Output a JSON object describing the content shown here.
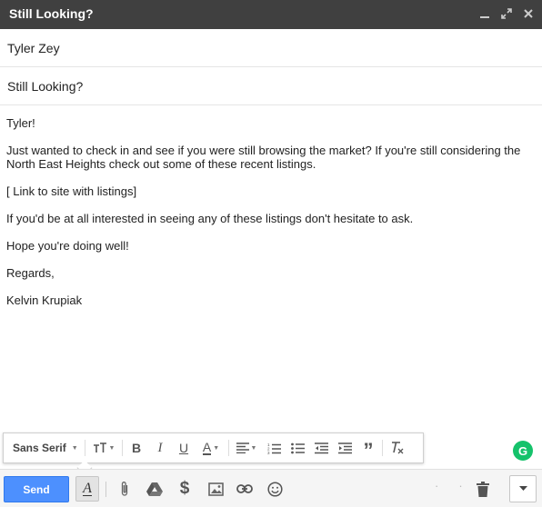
{
  "window": {
    "title": "Still Looking?"
  },
  "compose": {
    "to": "Tyler Zey",
    "subject": "Still Looking?",
    "body": [
      "Tyler!",
      "Just wanted to check in and see if you were still browsing the market? If you're still considering the North East Heights check out some of these recent listings.",
      "[ Link to site with listings]",
      "If you'd be at all interested in seeing any of these listings don't hesitate to ask.",
      "Hope you're doing well!",
      "Regards,",
      "Kelvin Krupiak"
    ]
  },
  "format_toolbar": {
    "font": "Sans Serif",
    "tools": [
      "font-size-icon",
      "bold-icon",
      "italic-icon",
      "underline-icon",
      "text-color-icon",
      "align-icon",
      "numbered-list-icon",
      "bulleted-list-icon",
      "indent-less-icon",
      "indent-more-icon",
      "quote-icon",
      "remove-formatting-icon"
    ]
  },
  "bottom_bar": {
    "send_label": "Send",
    "icons": [
      "formatting-toggle-icon",
      "attach-icon",
      "drive-icon",
      "money-icon",
      "photo-icon",
      "link-icon",
      "emoji-icon",
      "trash-icon",
      "more-options-icon"
    ]
  },
  "colors": {
    "titlebar": "#404040",
    "send_button": "#4d90fe",
    "grammarly": "#15c26b"
  }
}
